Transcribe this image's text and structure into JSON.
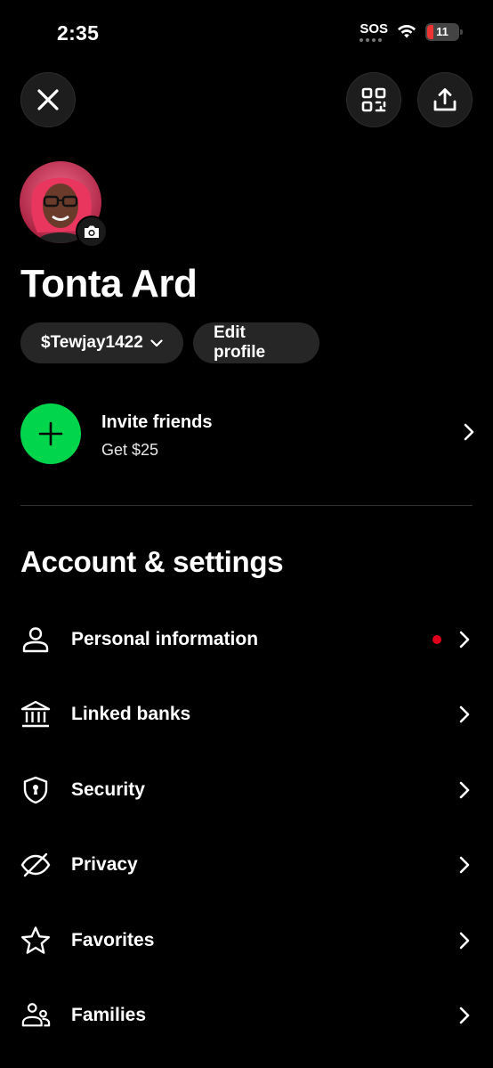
{
  "status_bar": {
    "time": "2:35",
    "sos": "SOS",
    "battery": "11",
    "battery_low_color": "#e33333"
  },
  "header": {
    "close_icon": "close-icon",
    "qr_icon": "qr-scan-icon",
    "share_icon": "share-icon"
  },
  "profile": {
    "name": "Tonta Ard",
    "cashtag": "$Tewjay1422",
    "edit_label": "Edit profile"
  },
  "invite": {
    "title": "Invite friends",
    "subtitle": "Get $25",
    "accent_color": "#00d54b"
  },
  "settings": {
    "title": "Account & settings",
    "items": [
      {
        "label": "Personal information",
        "icon": "person-icon",
        "notification_dot": true
      },
      {
        "label": "Linked banks",
        "icon": "bank-icon",
        "notification_dot": false
      },
      {
        "label": "Security",
        "icon": "shield-icon",
        "notification_dot": false
      },
      {
        "label": "Privacy",
        "icon": "eye-slash-icon",
        "notification_dot": false
      },
      {
        "label": "Favorites",
        "icon": "star-icon",
        "notification_dot": false
      },
      {
        "label": "Families",
        "icon": "family-icon",
        "notification_dot": false
      }
    ]
  }
}
